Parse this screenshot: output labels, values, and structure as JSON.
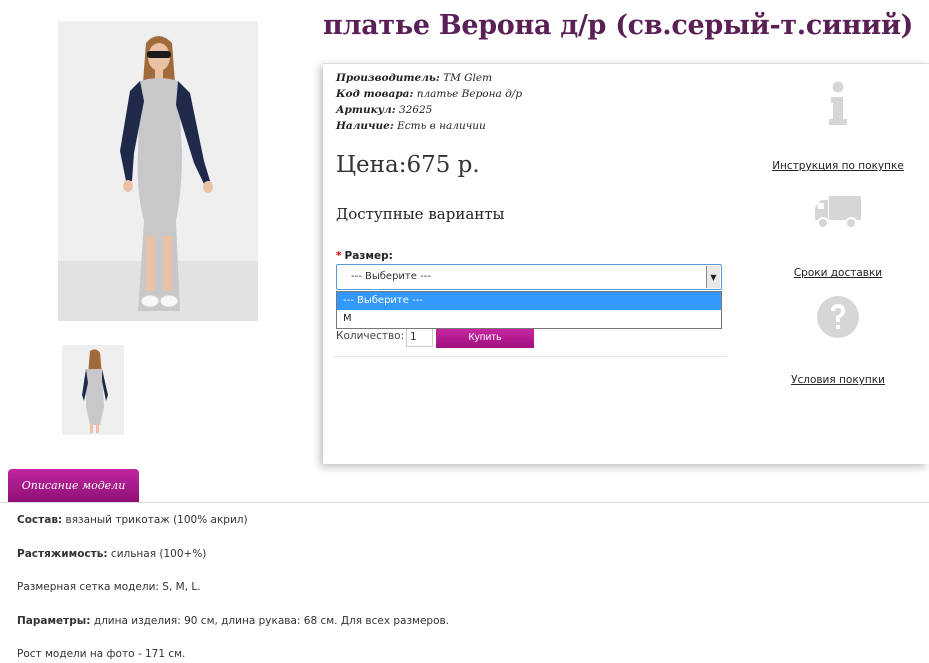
{
  "product": {
    "title": "платье Верона д/р (св.серый-т.синий)"
  },
  "meta": {
    "manufacturer_key": "Производитель:",
    "manufacturer_val": "TM Glem",
    "code_key": "Код товара:",
    "code_val": "платье Верона д/р",
    "sku_key": "Артикул:",
    "sku_val": "32625",
    "stock_key": "Наличие:",
    "stock_val": "Есть в наличии"
  },
  "price": "Цена:675 р.",
  "variants": {
    "title": "Доступные варианты",
    "size_label": "Размер:",
    "required_mark": "*",
    "selected": "--- Выберите ---",
    "options": [
      "--- Выберите ---",
      "M"
    ]
  },
  "purchase": {
    "qty_label": "Количество:",
    "qty_value": "1",
    "buy_label": "Купить"
  },
  "side_links": {
    "instructions": "Инструкция по покупке",
    "delivery": "Сроки доставки",
    "terms": "Условия покупки"
  },
  "tab": {
    "label": "Описание модели"
  },
  "description": {
    "composition_key": "Состав:",
    "composition_val": " вязаный трикотаж (100% акрил)",
    "stretch_key": "Растяжимость:",
    "stretch_val": " сильная (100+%)",
    "sizes": "Размерная сетка модели: S, M, L.",
    "params_key": "Параметры:",
    "params_val": " длина изделия: 90 см, длина рукава: 68 см. Для всех размеров.",
    "model_height": "Рост модели на фото - 171 см."
  },
  "colors": {
    "title": "#5a1f55",
    "accent": "#b01c90",
    "select_highlight": "#3399ff",
    "icon_gray": "#d6d6d6"
  },
  "icons": [
    "info-icon",
    "truck-icon",
    "question-icon",
    "chevron-down-icon"
  ]
}
